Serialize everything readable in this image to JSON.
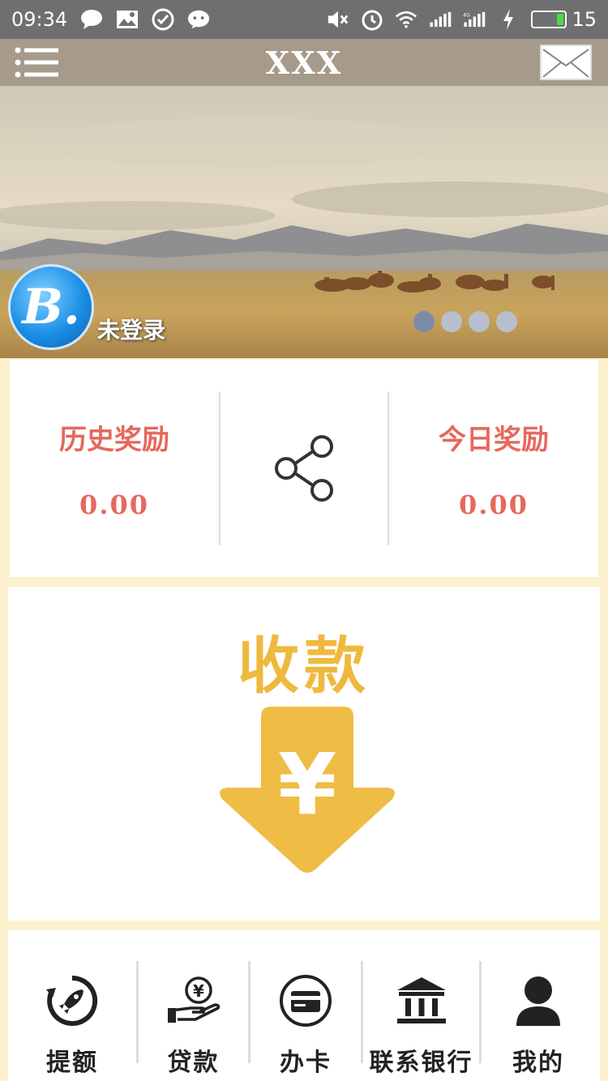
{
  "status_bar": {
    "time": "09:34",
    "battery_level": "15",
    "icons": [
      "message-icon",
      "image-icon",
      "check-icon",
      "wechat-icon",
      "mute-icon",
      "alarm-icon",
      "wifi-icon",
      "signal-icon",
      "4g-signal-icon",
      "charging-icon",
      "battery-icon"
    ]
  },
  "header": {
    "title": "XXX",
    "menu_icon": "menu-icon",
    "mail_icon": "mail-icon"
  },
  "banner": {
    "avatar_letter": "B.",
    "login_status": "未登录",
    "carousel_dots": 4,
    "active_dot": 0
  },
  "rewards": {
    "history_label": "历史奖励",
    "history_value": "0.00",
    "share_icon": "share-icon",
    "today_label": "今日奖励",
    "today_value": "0.00"
  },
  "receive": {
    "title": "收款",
    "icon": "yuan-down-arrow-icon",
    "symbol": "¥"
  },
  "bottom_nav": {
    "items": [
      {
        "label": "提额",
        "icon": "rocket-icon"
      },
      {
        "label": "贷款",
        "icon": "loan-hand-icon"
      },
      {
        "label": "办卡",
        "icon": "card-icon"
      },
      {
        "label": "联系银行",
        "icon": "bank-icon"
      },
      {
        "label": "我的",
        "icon": "user-icon"
      }
    ]
  },
  "colors": {
    "accent_red": "#e6685c",
    "accent_gold": "#efb93f",
    "header_bg": "#a69b8b",
    "status_bg": "#6f6f6f",
    "page_bg": "#fbf1cf"
  }
}
